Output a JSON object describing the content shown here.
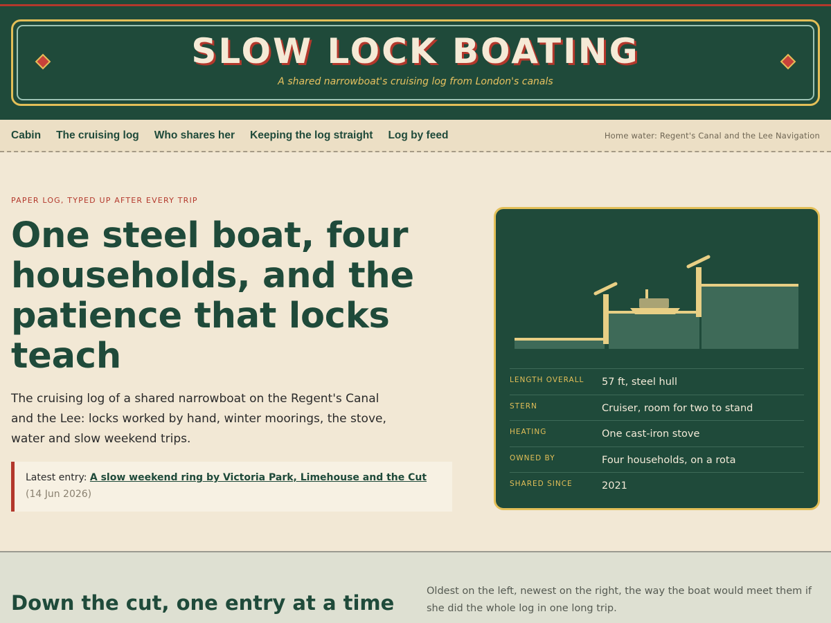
{
  "site": {
    "title": "SLOW LOCK BOATING",
    "subtitle": "A shared narrowboat's cruising log from London's canals"
  },
  "nav": {
    "items": [
      "Cabin",
      "The cruising log",
      "Who shares her",
      "Keeping the log straight",
      "Log by feed"
    ],
    "home_water": "Home water: Regent's Canal and the Lee Navigation"
  },
  "hero": {
    "kicker": "PAPER LOG, TYPED UP AFTER EVERY TRIP",
    "headline": "One steel boat, four households, and the patience that locks teach",
    "lede": "The cruising log of a shared narrowboat on the Regent's Canal and the Lee: locks worked by hand, winter moorings, the stove, water and slow weekend trips.",
    "latest_prefix": "Latest entry:",
    "latest_title": "A slow weekend ring by Victoria Park, Limehouse and the Cut",
    "latest_date": "(14 Jun 2026)"
  },
  "boat_card": {
    "specs": [
      {
        "label": "LENGTH OVERALL",
        "value": "57 ft, steel hull"
      },
      {
        "label": "STERN",
        "value": "Cruiser, room for two to stand"
      },
      {
        "label": "HEATING",
        "value": "One cast-iron stove"
      },
      {
        "label": "OWNED BY",
        "value": "Four households, on a rota"
      },
      {
        "label": "SHARED SINCE",
        "value": "2021"
      }
    ]
  },
  "section2": {
    "title": "Down the cut, one entry at a time",
    "note": "Oldest on the left, newest on the right, the way the boat would meet them if she did the whole log in one long trip."
  },
  "colors": {
    "green": "#1f4a3a",
    "gold": "#e3bf58",
    "red": "#b3382c",
    "cream": "#f2e8d5"
  }
}
